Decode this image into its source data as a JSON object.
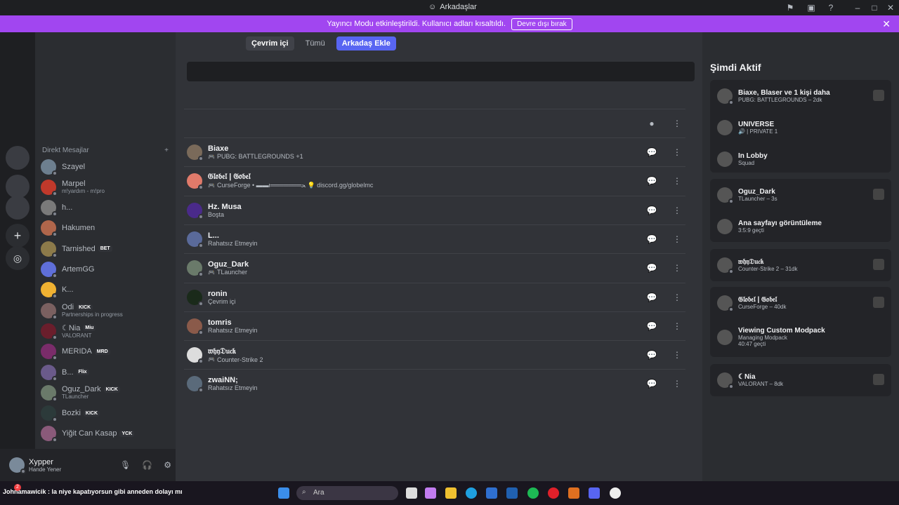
{
  "window": {
    "title": "Arkadaşlar"
  },
  "banner": {
    "text": "Yayıncı Modu etkinleştirildi. Kullanıcı adları kısaltıldı.",
    "button": "Devre dışı bırak"
  },
  "tabs": [
    {
      "label": "Çevrim içi"
    },
    {
      "label": "Tümü"
    },
    {
      "label": "Arkadaş Ekle"
    }
  ],
  "dm": {
    "header": "Direkt Mesajlar",
    "items": [
      {
        "name": "Szayel",
        "sub": "",
        "badge": "",
        "status": "off",
        "color": "#6d7f8f"
      },
      {
        "name": "Marpel",
        "sub": "m!yardım - m!pro",
        "badge": "",
        "status": "on",
        "color": "#c0392b"
      },
      {
        "name": "h...",
        "sub": "",
        "badge": "",
        "status": "off",
        "color": "#7a7a7a"
      },
      {
        "name": "Hakumen",
        "sub": "",
        "badge": "",
        "status": "off",
        "color": "#b0664b"
      },
      {
        "name": "Tarnished",
        "sub": "",
        "badge": "BET",
        "status": "off",
        "color": "#8c7a4a"
      },
      {
        "name": "ArtemGG",
        "sub": "",
        "badge": "",
        "status": "off",
        "color": "#5f6fd9"
      },
      {
        "name": "K...",
        "sub": "",
        "badge": "",
        "status": "off",
        "color": "#f0b232"
      },
      {
        "name": "Odi",
        "sub": "Partnerships in progress",
        "badge": "KICK",
        "status": "dnd",
        "color": "#7a6060"
      },
      {
        "name": "☾Nia",
        "sub": "VALORANT",
        "badge": "Miu",
        "status": "dnd",
        "color": "#6a1e2c"
      },
      {
        "name": "MERIDA",
        "sub": "",
        "badge": "MRD",
        "status": "off",
        "color": "#7a2c6a"
      },
      {
        "name": "B...",
        "sub": "",
        "badge": "Flix",
        "status": "idle",
        "color": "#6a5a8a"
      },
      {
        "name": "Oguz_Dark",
        "sub": "TLauncher",
        "badge": "KICK",
        "status": "on",
        "color": "#6a7a6a"
      },
      {
        "name": "Bozki",
        "sub": "",
        "badge": "KICK",
        "status": "off",
        "color": "#2c3a3a"
      },
      {
        "name": "Yiğit Can Kasap",
        "sub": "",
        "badge": "YCK",
        "status": "off",
        "color": "#8a5a7a"
      }
    ]
  },
  "user": {
    "name": "Xypper",
    "status": "Hande Yener"
  },
  "friends": [
    {
      "name": "Biaxe",
      "sub": "PUBG: BATTLEGROUNDS +1",
      "status": "on",
      "color": "#7a6a5a",
      "game": true
    },
    {
      "name": "𝔊𝔩𝔬𝔟𝔢𝔩 | 𝔊𝔬𝔟𝔢𝔩",
      "sub": "CurseForge • ▬▬ι═══════ﺤ 💡 discord.gg/globelmc",
      "status": "on",
      "color": "#e07a6a",
      "game": true
    },
    {
      "name": "Hz. Musa",
      "sub": "Boşta",
      "status": "idle",
      "color": "#4a2a8a",
      "game": false
    },
    {
      "name": "L...",
      "sub": "Rahatsız Etmeyin",
      "status": "dnd",
      "color": "#5a6a9a",
      "game": false
    },
    {
      "name": "Oguz_Dark",
      "sub": "TLauncher",
      "status": "on",
      "color": "#6a7a6a",
      "game": true
    },
    {
      "name": "ronin",
      "sub": "Çevrim içi",
      "status": "on",
      "color": "#1a2a1a",
      "game": false
    },
    {
      "name": "tomris",
      "sub": "Rahatsız Etmeyin",
      "status": "dnd",
      "color": "#8a5a4a",
      "game": false
    },
    {
      "name": "𝔴𝔥𝔶𝔇𝔲𝔠𝔨",
      "sub": "Counter-Strike 2",
      "status": "dnd",
      "color": "#dddddd",
      "game": true
    },
    {
      "name": "zwaiNN;",
      "sub": "Rahatsız Etmeyin",
      "status": "dnd",
      "color": "#5a6a7a",
      "game": false
    }
  ],
  "active_now": {
    "heading": "Şimdi Aktif",
    "cards": [
      {
        "rows": [
          {
            "t1": "Biaxe, Blaser ve 1 kişi daha",
            "t2": "PUBG: BATTLEGROUNDS – 2dk",
            "t3": ""
          },
          {
            "t1": "UNIVERSE",
            "t2": "🔊 | PRIVATE 1",
            "t3": ""
          },
          {
            "t1": "In Lobby",
            "t2": "Squad",
            "t3": ""
          }
        ]
      },
      {
        "rows": [
          {
            "t1": "Oguz_Dark",
            "t2": "TLauncher – 3s",
            "t3": ""
          },
          {
            "t1": "Ana sayfayı görüntüleme",
            "t2": "3:5:9 geçti",
            "t3": ""
          }
        ]
      },
      {
        "rows": [
          {
            "t1": "𝔴𝔥𝔶𝔇𝔲𝔠𝔨",
            "t2": "Counter-Strike 2 – 31dk",
            "t3": ""
          }
        ]
      },
      {
        "rows": [
          {
            "t1": "𝔊𝔩𝔬𝔟𝔢𝔩 | 𝔊𝔬𝔟𝔢𝔩",
            "t2": "CurseForge – 40dk",
            "t3": ""
          },
          {
            "t1": "Viewing Custom Modpack",
            "t2": "Managing Modpack",
            "t3": "40:47 geçti"
          }
        ]
      },
      {
        "rows": [
          {
            "t1": "☾Nia",
            "t2": "VALORANT – 8dk",
            "t3": ""
          }
        ]
      }
    ]
  },
  "taskbar": {
    "chat": "Johnamawicik : la niye kapatıyorsun gibi anneden dolayı mı",
    "search_placeholder": "Ara",
    "chat_badge": "2"
  }
}
